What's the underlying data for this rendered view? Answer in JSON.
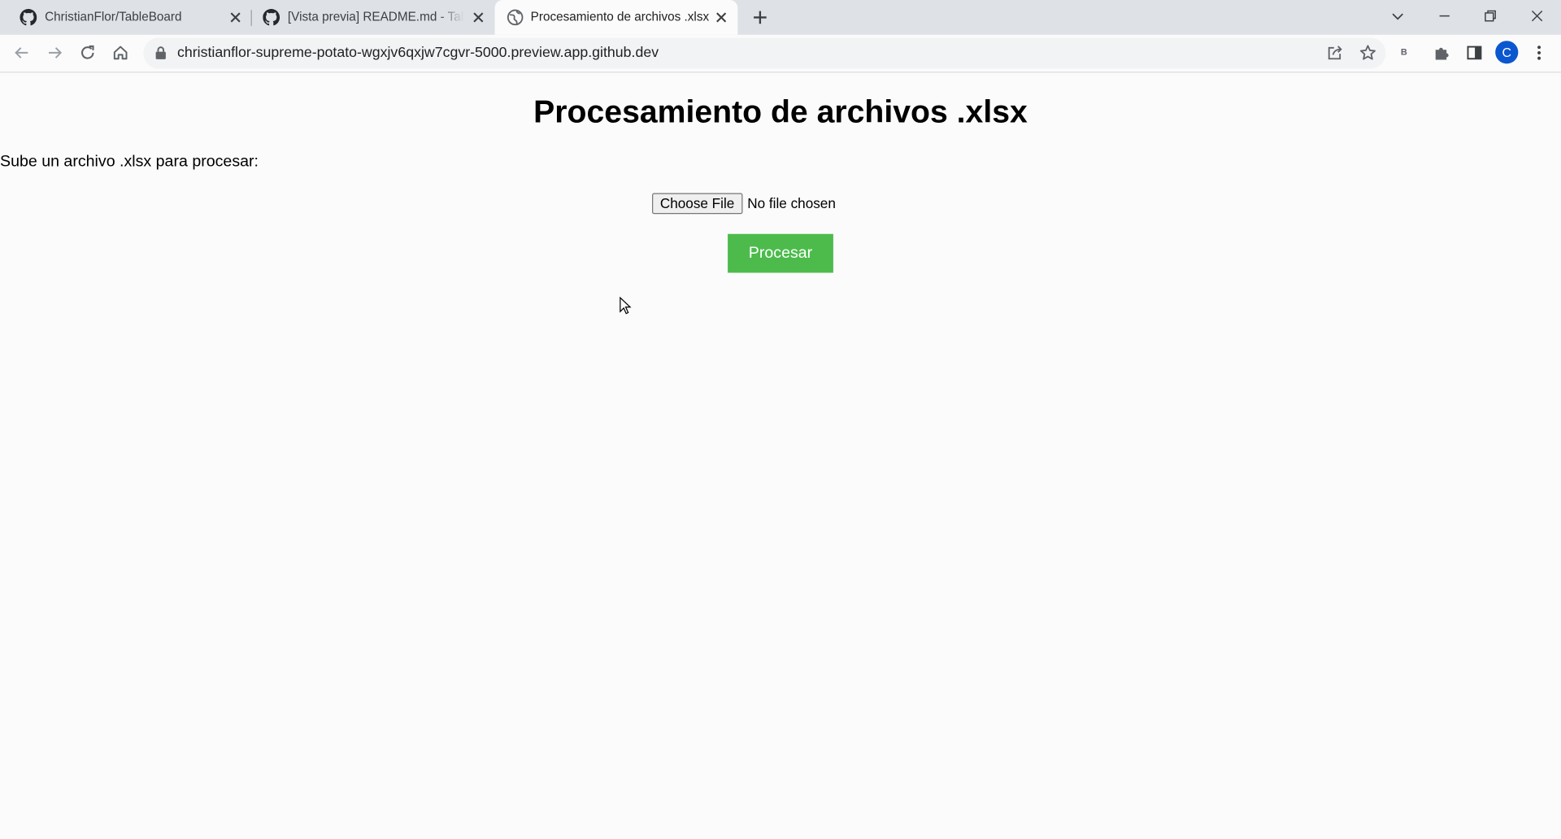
{
  "browser": {
    "tabs": [
      {
        "title": "ChristianFlor/TableBoard",
        "favicon": "github-icon",
        "active": false
      },
      {
        "title": "[Vista previa] README.md - Table",
        "favicon": "github-icon",
        "active": false
      },
      {
        "title": "Procesamiento de archivos .xlsx",
        "favicon": "globe-icon",
        "active": true
      }
    ],
    "url": "christianflor-supreme-potato-wgxjv6qxjw7cgvr-5000.preview.app.github.dev",
    "extension_letter": "B",
    "profile_initial": "C",
    "profile_color": "#0b57d0"
  },
  "page": {
    "heading": "Procesamiento de archivos .xlsx",
    "prompt": "Sube un archivo .xlsx para procesar:",
    "file_input": {
      "button_label": "Choose File",
      "status": "No file chosen"
    },
    "submit_label": "Procesar",
    "submit_color": "#4cbb4c"
  }
}
